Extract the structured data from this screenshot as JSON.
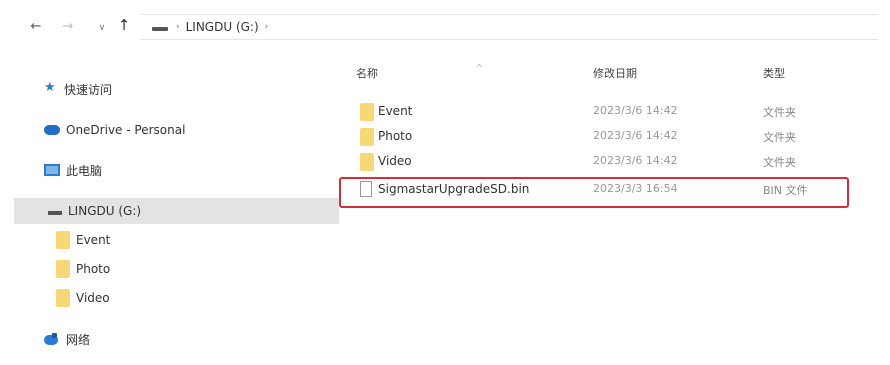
{
  "nav": {
    "back_icon": "arrow-left-icon",
    "forward_icon": "arrow-right-icon",
    "up_icon": "arrow-up-icon",
    "breadcrumb": [
      "LINGDU (G:)"
    ]
  },
  "sidebar": {
    "items": [
      {
        "label": "快速访问",
        "icon": "star-icon"
      },
      {
        "label": "OneDrive - Personal",
        "icon": "cloud-icon"
      },
      {
        "label": "此电脑",
        "icon": "computer-icon"
      },
      {
        "label": "LINGDU (G:)",
        "icon": "drive-icon",
        "selected": true
      },
      {
        "label": "Event",
        "icon": "folder-icon"
      },
      {
        "label": "Photo",
        "icon": "folder-icon"
      },
      {
        "label": "Video",
        "icon": "folder-icon"
      },
      {
        "label": "网络",
        "icon": "network-icon"
      }
    ]
  },
  "columns": {
    "name": "名称",
    "date": "修改日期",
    "type": "类型"
  },
  "files": [
    {
      "name": "Event",
      "date": "2023/3/6 14:42",
      "type": "文件夹",
      "icon": "folder-icon"
    },
    {
      "name": "Photo",
      "date": "2023/3/6 14:42",
      "type": "文件夹",
      "icon": "folder-icon"
    },
    {
      "name": "Video",
      "date": "2023/3/6 14:42",
      "type": "文件夹",
      "icon": "folder-icon"
    },
    {
      "name": "SigmastarUpgradeSD.bin",
      "date": "2023/3/3 16:54",
      "type": "BIN 文件",
      "icon": "file-icon",
      "highlighted": true
    }
  ],
  "colors": {
    "highlight_border": "#d32f3a",
    "selected_bg": "#e3e3e3",
    "folder": "#f8d775",
    "accent": "#2b7bd6"
  }
}
